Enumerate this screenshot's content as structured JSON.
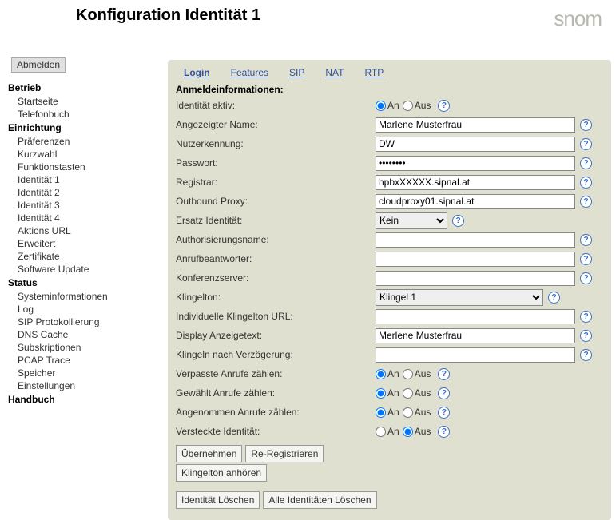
{
  "header": {
    "title": "Konfiguration Identität 1",
    "logo": "snom"
  },
  "sidebar": {
    "logout": "Abmelden",
    "groups": [
      {
        "title": "Betrieb",
        "items": [
          "Startseite",
          "Telefonbuch"
        ]
      },
      {
        "title": "Einrichtung",
        "items": [
          "Präferenzen",
          "Kurzwahl",
          "Funktionstasten",
          "Identität 1",
          "Identität 2",
          "Identität 3",
          "Identität 4",
          "Aktions URL",
          "Erweitert",
          "Zertifikate",
          "Software Update"
        ]
      },
      {
        "title": "Status",
        "items": [
          "Systeminformationen",
          "Log",
          "SIP Protokollierung",
          "DNS Cache",
          "Subskriptionen",
          "PCAP Trace",
          "Speicher",
          "Einstellungen"
        ]
      },
      {
        "title": "Handbuch",
        "items": []
      }
    ]
  },
  "tabs": {
    "items": [
      "Login",
      "Features",
      "SIP",
      "NAT",
      "RTP"
    ],
    "active": 0
  },
  "form": {
    "section_title": "Anmeldeinformationen:",
    "radio_on": "An",
    "radio_off": "Aus",
    "rows": {
      "identity_active_label": "Identität aktiv:",
      "displayname_label": "Angezeigter Name:",
      "displayname_value": "Marlene Musterfrau",
      "account_label": "Nutzerkennung:",
      "account_value": "DW",
      "password_label": "Passwort:",
      "password_value": "••••••••",
      "registrar_label": "Registrar:",
      "registrar_value": "hpbxXXXXX.sipnal.at",
      "outbound_label": "Outbound Proxy:",
      "outbound_value": "cloudproxy01.sipnal.at",
      "failover_label": "Ersatz Identität:",
      "failover_value": "Kein",
      "authname_label": "Authorisierungsname:",
      "authname_value": "",
      "mailbox_label": "Anrufbeantworter:",
      "mailbox_value": "",
      "conference_label": "Konferenzserver:",
      "conference_value": "",
      "ringtone_label": "Klingelton:",
      "ringtone_value": "Klingel 1",
      "ringtone_url_label": "Individuelle Klingelton URL:",
      "ringtone_url_value": "",
      "display_text_label": "Display Anzeigetext:",
      "display_text_value": "Merlene Musterfrau",
      "ring_delay_label": "Klingeln nach Verzögerung:",
      "ring_delay_value": "",
      "missed_label": "Verpasste Anrufe zählen:",
      "dialed_label": "Gewählt Anrufe zählen:",
      "received_label": "Angenommen Anrufe zählen:",
      "hidden_label": "Versteckte Identität:"
    }
  },
  "buttons": {
    "apply": "Übernehmen",
    "reregister": "Re-Registrieren",
    "play_ringer": "Klingelton anhören",
    "remove_identity": "Identität Löschen",
    "remove_all": "Alle Identitäten Löschen"
  }
}
